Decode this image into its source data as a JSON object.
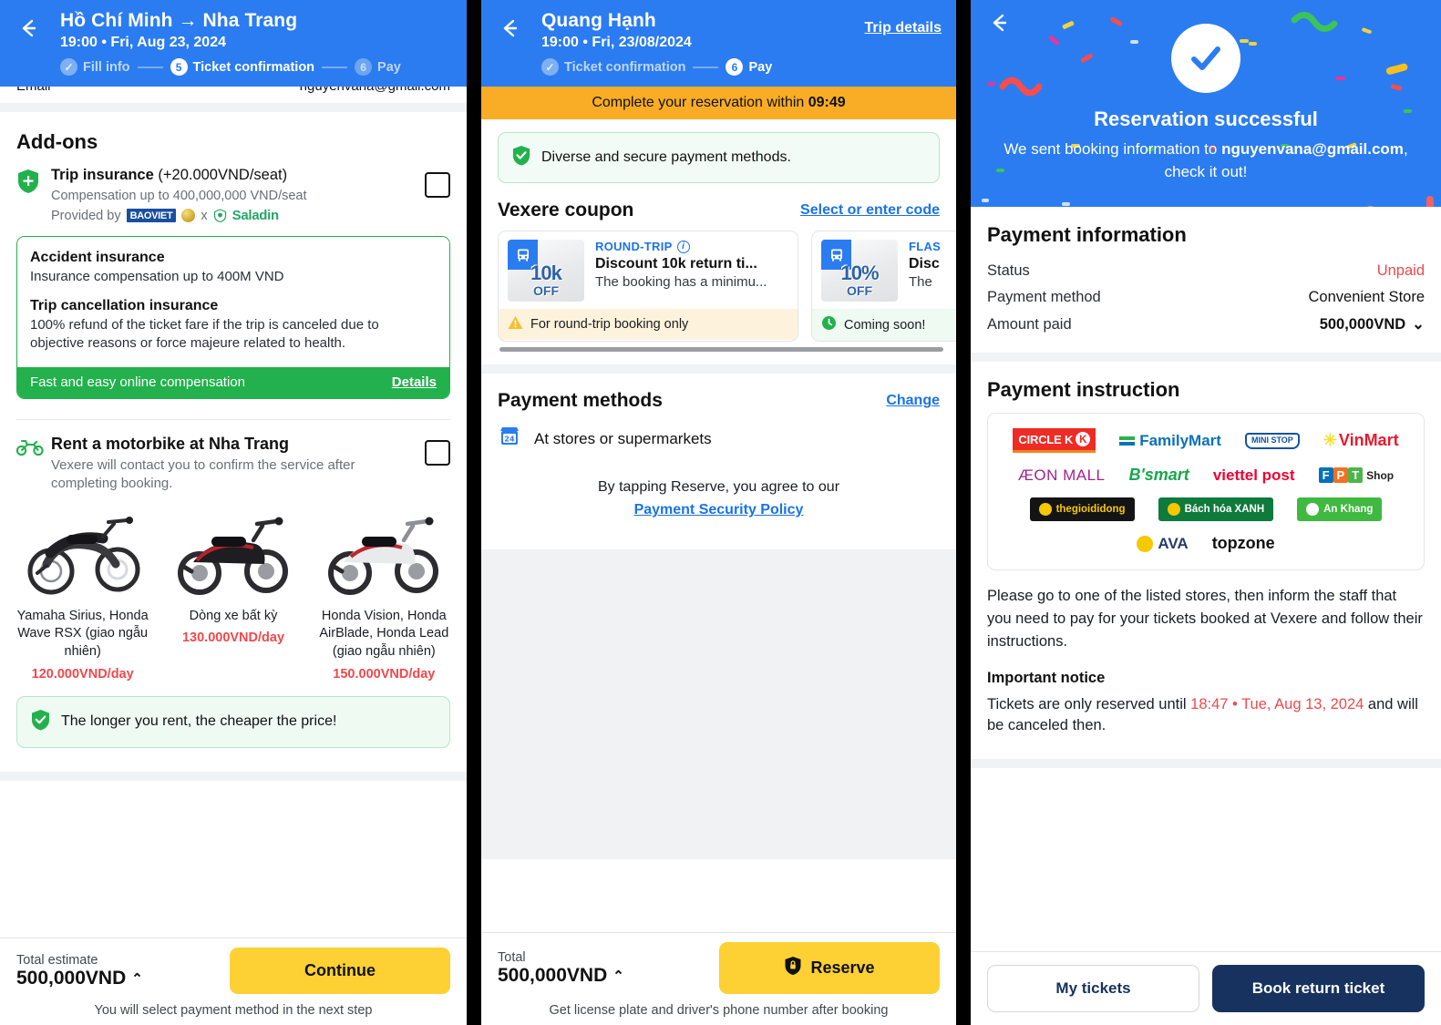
{
  "panel1": {
    "header": {
      "back_icon": "back-arrow-icon",
      "title": "Hồ Chí Minh → Nha Trang",
      "subtitle": "19:00 • Fri, Aug 23, 2024",
      "steps": [
        {
          "num": "✓",
          "label": "Fill info",
          "state": "done"
        },
        {
          "num": "5",
          "label": "Ticket confirmation",
          "state": "active"
        },
        {
          "num": "6",
          "label": "Pay",
          "state": "pending"
        }
      ]
    },
    "email_row": {
      "label": "Email",
      "value": "nguyenvana@gmail.com"
    },
    "section_title": "Add-ons",
    "insurance": {
      "icon": "shield-icon",
      "title_bold": "Trip insurance",
      "title_rest": " (+20.000VND/seat)",
      "note": "Compensation up to 400,000,000 VND/seat",
      "provided_by": "Provided by",
      "provider1": "BAOVIET",
      "provider_sep": "x",
      "provider2": "Saladin",
      "card": {
        "h1": "Accident insurance",
        "p1": "Insurance compensation up to 400M VND",
        "h2": "Trip cancellation insurance",
        "p2": "100% refund of the ticket fare if the trip is canceled due to objective reasons or force majeure related to health.",
        "footer_text": "Fast and easy online compensation",
        "footer_link": "Details"
      }
    },
    "motorbike": {
      "icon": "motorbike-icon",
      "title": "Rent a motorbike at Nha Trang",
      "desc": "Vexere will contact you to confirm the service after completing booking.",
      "options": [
        {
          "name": "Yamaha Sirius, Honda Wave RSX (giao ngẫu nhiên)",
          "price": "120.000VND/day"
        },
        {
          "name": "Dòng xe bất kỳ",
          "price": "130.000VND/day"
        },
        {
          "name": "Honda Vision, Honda AirBlade, Honda Lead (giao ngẫu nhiên)",
          "price": "150.000VND/day"
        }
      ],
      "tip": "The longer you rent, the cheaper the price!"
    },
    "footer": {
      "total_label": "Total estimate",
      "total_value": "500,000VND",
      "caret": "⌃",
      "cta": "Continue",
      "note": "You will select payment method in the next step"
    }
  },
  "panel2": {
    "header": {
      "back_icon": "back-arrow-icon",
      "title": "Quang Hạnh",
      "subtitle": "19:00 • Fri, 23/08/2024",
      "trip_details": "Trip details",
      "steps": [
        {
          "num": "✓",
          "label": "Ticket confirmation",
          "state": "done"
        },
        {
          "num": "6",
          "label": "Pay",
          "state": "active"
        }
      ]
    },
    "timer": {
      "text": "Complete your reservation within ",
      "value": "09:49"
    },
    "secure_notice": "Diverse and secure payment methods.",
    "coupon": {
      "title": "Vexere coupon",
      "action": "Select or enter code",
      "cards": [
        {
          "thumb_pct": "10k",
          "thumb_off": "OFF",
          "tag": "ROUND-TRIP",
          "name": "Discount 10k return ti...",
          "sub": "The booking has a minimu...",
          "foot": "For round-trip booking only",
          "foot_style": "warn"
        },
        {
          "thumb_pct": "10%",
          "thumb_off": "OFF",
          "tag": "FLAS",
          "name": "Disc",
          "sub": "The ",
          "foot": "Coming soon! ",
          "foot_style": "soon"
        }
      ]
    },
    "payment_methods": {
      "title": "Payment methods",
      "change": "Change",
      "selected_icon": "store-24h-icon",
      "selected": "At stores or supermarkets",
      "agree_text": "By tapping Reserve, you agree to our",
      "agree_link": "Payment Security Policy"
    },
    "footer": {
      "total_label": "Total",
      "total_value": "500,000VND",
      "caret": "⌃",
      "cta": "Reserve",
      "cta_icon": "lock-shield-icon",
      "note": "Get license plate and driver's phone number after booking"
    }
  },
  "panel3": {
    "header": {
      "back_icon": "back-arrow-icon",
      "check_icon": "check-circle-icon"
    },
    "success": {
      "title": "Reservation successful",
      "sub_pre": "We sent booking information to ",
      "email": "nguyenvana@gmail.com",
      "sub_post": ", check it out!"
    },
    "payment_information": {
      "title": "Payment information",
      "rows": [
        {
          "label": "Status",
          "value": "Unpaid",
          "style": "unpaid"
        },
        {
          "label": "Payment method",
          "value": "Convenient Store",
          "style": "normal"
        },
        {
          "label": "Amount paid",
          "value": "500,000VND",
          "style": "amount",
          "caret": "⌄"
        }
      ]
    },
    "payment_instruction": {
      "title": "Payment instruction",
      "stores": [
        [
          "CIRCLE K",
          "FamilyMart",
          "MINI STOP",
          "VinMart"
        ],
        [
          "ÆON MALL",
          "B'smart",
          "viettel post",
          "FPT Shop"
        ],
        [
          "thegioididong",
          "Bách hóa XANH",
          "An Khang"
        ],
        [
          "AVA",
          "topzone"
        ]
      ],
      "instruction": "Please go to one of the listed stores, then inform the staff that you need to pay for your tickets booked at Vexere and follow their instructions.",
      "notice_title": "Important notice",
      "notice_pre": "Tickets are only reserved until ",
      "notice_deadline": "18:47 • Tue, Aug 13, 2024",
      "notice_post": " and will be canceled then."
    },
    "footer": {
      "secondary": "My tickets",
      "primary": "Book return ticket"
    }
  },
  "colors": {
    "brand_blue": "#2b7cf0",
    "yellow": "#fdd134",
    "green": "#22b14c",
    "red": "#f0484c",
    "navy": "#17325e",
    "amber": "#f9ac25"
  }
}
